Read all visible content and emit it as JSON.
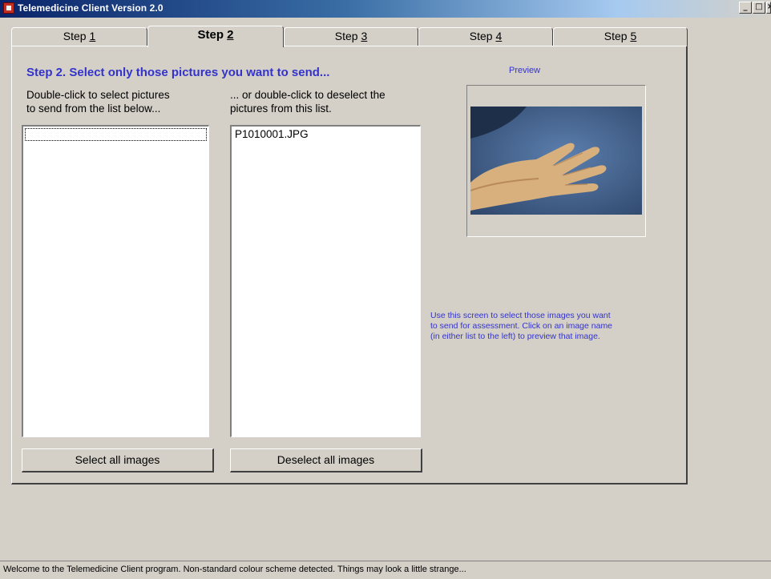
{
  "window": {
    "title": "Telemedicine Client Version 2.0",
    "controls": [
      "_",
      "□",
      "×"
    ]
  },
  "tabs": [
    {
      "prefix": "Step ",
      "key": "1",
      "active": false
    },
    {
      "prefix": "Step ",
      "key": "2",
      "active": true
    },
    {
      "prefix": "Step ",
      "key": "3",
      "active": false
    },
    {
      "prefix": "Step ",
      "key": "4",
      "active": false
    },
    {
      "prefix": "Step ",
      "key": "5",
      "active": false
    }
  ],
  "step": {
    "heading": "Step 2. Select only those pictures you want to send...",
    "left_instruction_1": "Double-click to select pictures",
    "left_instruction_2": "to send from the list below...",
    "right_instruction_1": "... or double-click to deselect the",
    "right_instruction_2": "pictures from this list.",
    "available_pictures": [],
    "selected_pictures": [
      "P1010001.JPG"
    ],
    "select_all_label": "Select all images",
    "deselect_all_label": "Deselect all images"
  },
  "preview": {
    "label": "Preview",
    "help_line_1": "Use this screen to select those images you want",
    "help_line_2": "to send for assessment. Click on an image name",
    "help_line_3": "(in either list to the left) to preview that image."
  },
  "statusbar": {
    "text": "Welcome to the Telemedicine Client program. Non-standard colour scheme detected. Things may look a little strange..."
  },
  "colors": {
    "accent_text": "#3333cc",
    "face": "#d4d0c8",
    "titlebar_start": "#0a246a"
  }
}
